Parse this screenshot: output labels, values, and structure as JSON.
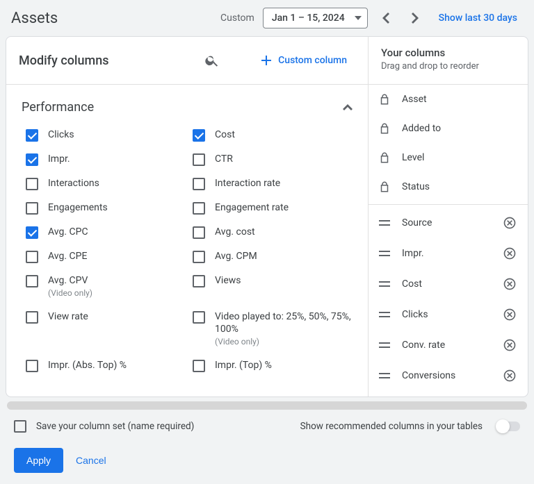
{
  "topbar": {
    "title": "Assets",
    "custom_label": "Custom",
    "date_range": "Jan 1 – 15, 2024",
    "last30": "Show last 30 days"
  },
  "modify": {
    "title": "Modify columns",
    "custom_column": "Custom column"
  },
  "your_columns": {
    "title": "Your columns",
    "subtitle": "Drag and drop to reorder"
  },
  "section": {
    "performance": "Performance"
  },
  "metrics_left": [
    {
      "label": "Clicks",
      "checked": true
    },
    {
      "label": "Impr.",
      "checked": true
    },
    {
      "label": "Interactions",
      "checked": false
    },
    {
      "label": "Engagements",
      "checked": false
    },
    {
      "label": "Avg. CPC",
      "checked": true
    },
    {
      "label": "Avg. CPE",
      "checked": false
    },
    {
      "label": "Avg. CPV",
      "sub": "(Video only)",
      "checked": false
    },
    {
      "label": "View rate",
      "checked": false
    },
    {
      "label": "Impr. (Abs. Top) %",
      "checked": false
    }
  ],
  "metrics_right": [
    {
      "label": "Cost",
      "checked": true
    },
    {
      "label": "CTR",
      "checked": false
    },
    {
      "label": "Interaction rate",
      "checked": false
    },
    {
      "label": "Engagement rate",
      "checked": false
    },
    {
      "label": "Avg. cost",
      "checked": false
    },
    {
      "label": "Avg. CPM",
      "checked": false
    },
    {
      "label": "Views",
      "checked": false
    },
    {
      "label": "Video played to: 25%, 50%, 75%, 100%",
      "sub": "(Video only)",
      "checked": false
    },
    {
      "label": "Impr. (Top) %",
      "checked": false
    }
  ],
  "locked_columns": [
    {
      "label": "Asset"
    },
    {
      "label": "Added to"
    },
    {
      "label": "Level"
    },
    {
      "label": "Status"
    }
  ],
  "draggable_columns": [
    {
      "label": "Source"
    },
    {
      "label": "Impr."
    },
    {
      "label": "Cost"
    },
    {
      "label": "Clicks"
    },
    {
      "label": "Conv. rate"
    },
    {
      "label": "Conversions"
    }
  ],
  "footer": {
    "save_label": "Save your column set (name required)",
    "recommend_label": "Show recommended columns in your tables",
    "apply": "Apply",
    "cancel": "Cancel"
  }
}
